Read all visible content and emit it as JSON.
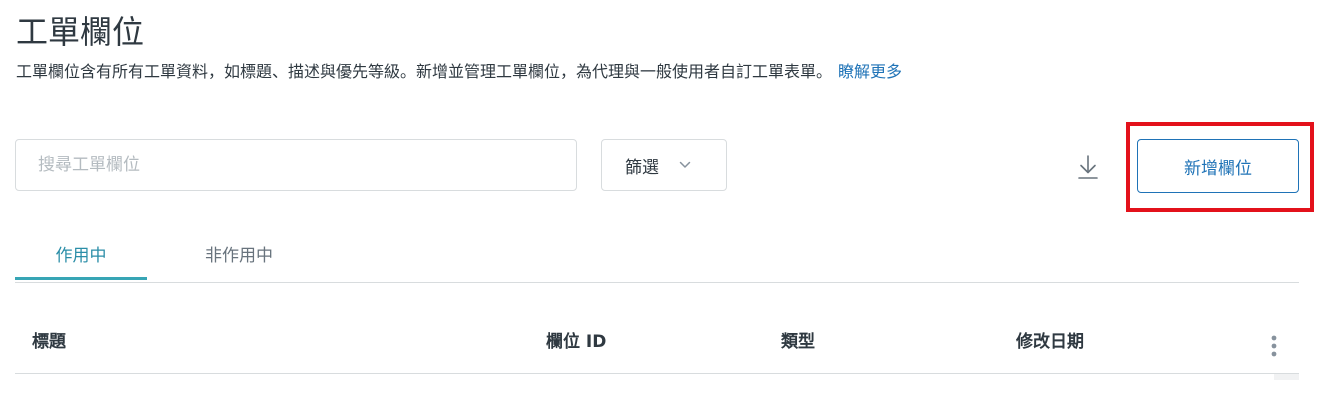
{
  "header": {
    "title": "工單欄位",
    "description": "工單欄位含有所有工單資料，如標題、描述與優先等級。新增並管理工單欄位，為代理與一般使用者自訂工單表單。",
    "learn_more_link": "瞭解更多"
  },
  "toolbar": {
    "search_placeholder": "搜尋工單欄位",
    "search_value": "",
    "filter_label": "篩選",
    "add_field_label": "新增欄位"
  },
  "icons": {
    "filter_chevron": "chevron-down-icon",
    "download": "download-icon",
    "more": "more-vertical-icon"
  },
  "tabs": [
    {
      "label": "作用中",
      "active": true
    },
    {
      "label": "非作用中",
      "active": false
    }
  ],
  "table": {
    "columns": [
      "標題",
      "欄位 ID",
      "類型",
      "修改日期"
    ]
  },
  "colors": {
    "accent_blue": "#1f73b7",
    "active_tab_underline": "#37a5b5",
    "highlight_red": "#e3111b",
    "border": "#d8dcde",
    "text": "#2f3941"
  }
}
